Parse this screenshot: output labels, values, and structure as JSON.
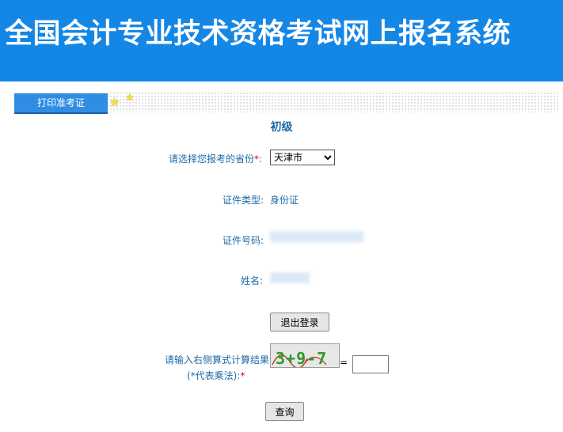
{
  "header": {
    "title": "全国会计专业技术资格考试网上报名系统"
  },
  "tabs": {
    "print_admission": "打印准考证"
  },
  "form": {
    "level": "初级",
    "province_label": "请选择您报考的省份",
    "province_required": "*",
    "province_suffix": ":",
    "province_selected": "天津市",
    "id_type_label": "证件类型:",
    "id_type_value": "身份证",
    "id_number_label": "证件号码:",
    "name_label": "姓名:",
    "logout_button": "退出登录",
    "captcha_label_1": "请输入右侧算式计算结果",
    "captcha_label_2": "(*代表乘法):",
    "captcha_required": "*",
    "captcha_expression": "3+9-7",
    "equals": "=",
    "answer_value": "",
    "query_button": "查询"
  },
  "colors": {
    "banner": "#1487e6",
    "tab": "#2f8de4",
    "label": "#1d6aa8",
    "required": "#e0001b"
  }
}
